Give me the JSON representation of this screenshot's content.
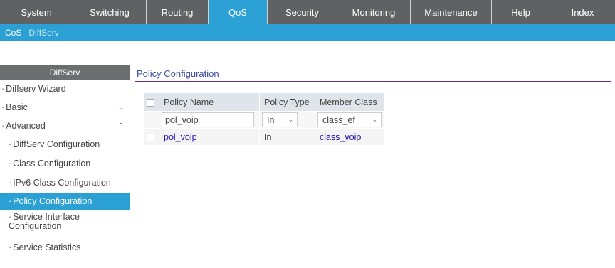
{
  "topnav": {
    "tabs": [
      {
        "label": "System"
      },
      {
        "label": "Switching"
      },
      {
        "label": "Routing"
      },
      {
        "label": "QoS"
      },
      {
        "label": "Security"
      },
      {
        "label": "Monitoring"
      },
      {
        "label": "Maintenance"
      },
      {
        "label": "Help"
      },
      {
        "label": "Index"
      }
    ],
    "active": "QoS"
  },
  "subnav": {
    "items": [
      {
        "label": "CoS"
      },
      {
        "label": "DiffServ"
      }
    ],
    "active": "DiffServ"
  },
  "sidebar": {
    "header": "DiffServ",
    "items": [
      {
        "label": "Diffserv Wizard"
      },
      {
        "label": "Basic",
        "chevron": "chevron-down-icon"
      },
      {
        "label": "Advanced",
        "chevron": "chevron-up-icon"
      }
    ],
    "sub_items": [
      {
        "label": "DiffServ Configuration"
      },
      {
        "label": "Class Configuration"
      },
      {
        "label": "IPv6 Class Configuration"
      },
      {
        "label": "Policy Configuration"
      },
      {
        "label": "Service Interface Configuration"
      },
      {
        "label": "Service Statistics"
      }
    ],
    "active": "Policy Configuration"
  },
  "main": {
    "section_title": "Policy Configuration",
    "table": {
      "headers": [
        "Policy Name",
        "Policy Type",
        "Member Class"
      ],
      "input_row": {
        "policy_name": "pol_voip",
        "policy_type": "In",
        "member_class": "class_ef"
      },
      "rows": [
        {
          "policy_name": "pol_voip",
          "policy_type": "In",
          "member_class": "class_voip"
        }
      ]
    }
  },
  "colors": {
    "accent": "#2aa0d4",
    "nav_bg": "#5f6163",
    "section_underline": "#6a2a8a"
  }
}
